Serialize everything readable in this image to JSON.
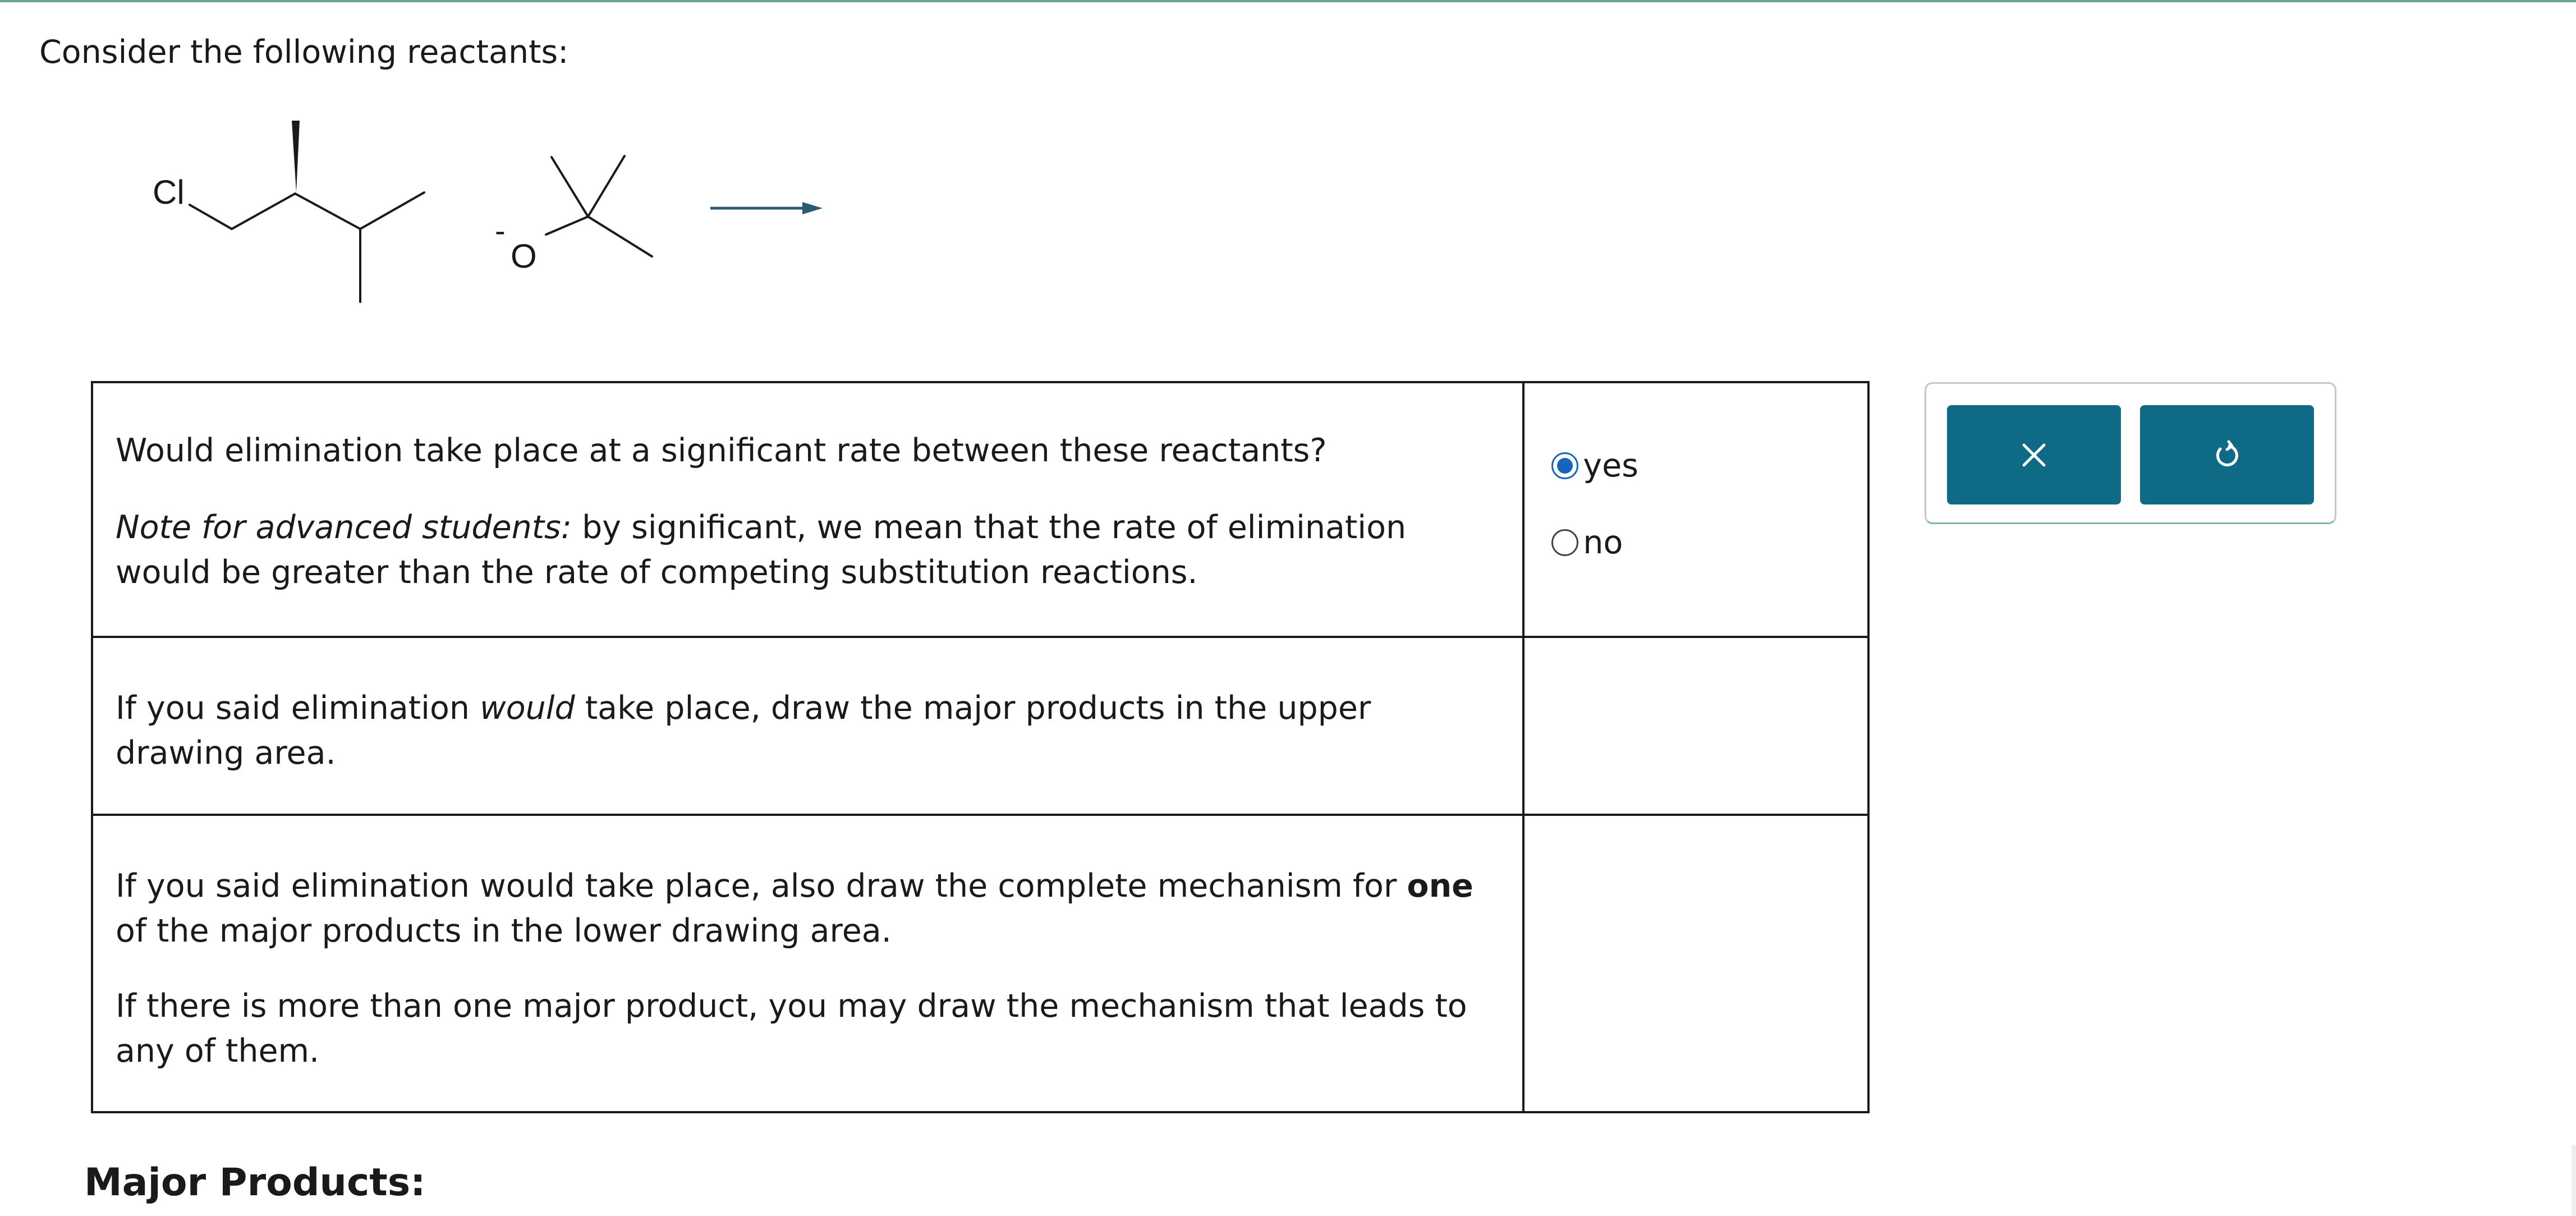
{
  "intro_text": "Consider the following reactants:",
  "reaction": {
    "reactant1_atom_label": "Cl",
    "reactant2_atom_label": "O",
    "reactant2_charge": "-"
  },
  "table": {
    "row1": {
      "question": "Would elimination take place at a significant rate between these reactants?",
      "note_label": "Note for advanced students:",
      "note_text": " by significant, we mean that the rate of elimination would be greater than the rate of competing substitution reactions."
    },
    "row2": {
      "text_before": "If you said elimination ",
      "text_em": "would",
      "text_after": " take place, draw the major products in the upper drawing area."
    },
    "row3": {
      "text_before": "If you said elimination would take place, also draw the complete mechanism for ",
      "text_strong": "one",
      "text_after": " of the major products in the lower drawing area.",
      "text2": "If there is more than one major product, you may draw the mechanism that leads to any of them."
    }
  },
  "options": [
    {
      "label": "yes",
      "selected": true
    },
    {
      "label": "no",
      "selected": false
    }
  ],
  "toolbar": {
    "clear_icon": "close-icon",
    "undo_icon": "undo-icon",
    "button_color": "#0f6a85"
  },
  "section_heading": "Major Products:"
}
